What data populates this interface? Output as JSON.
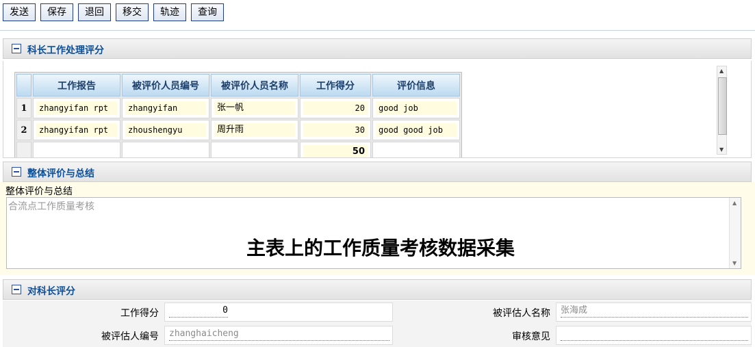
{
  "toolbar": {
    "send": "发送",
    "save": "保存",
    "return": "退回",
    "transfer": "移交",
    "track": "轨迹",
    "query": "查询"
  },
  "section1": {
    "title": "科长工作处理评分",
    "columns": [
      "工作报告",
      "被评价人员编号",
      "被评价人员名称",
      "工作得分",
      "评价信息"
    ],
    "rows": [
      {
        "no": "1",
        "report": "zhangyifan rpt",
        "id": "zhangyifan",
        "name": "张一帆",
        "score": "20",
        "info": "good job"
      },
      {
        "no": "2",
        "report": "zhangyifan rpt",
        "id": "zhoushengyu",
        "name": "周升雨",
        "score": "30",
        "info": "good good job"
      }
    ],
    "total_score": "50"
  },
  "section2": {
    "title": "整体评价与总结",
    "field_label": "整体评价与总结",
    "field_value": "合流点工作质量考核",
    "caption": "主表上的工作质量考核数据采集"
  },
  "section3": {
    "title": "对科长评分",
    "score_label": "工作得分",
    "score_value": "0",
    "name_label": "被评估人名称",
    "name_value": "张海成",
    "id_label": "被评估人编号",
    "id_value": "zhanghaicheng",
    "review_label": "审核意见",
    "review_value": ""
  }
}
